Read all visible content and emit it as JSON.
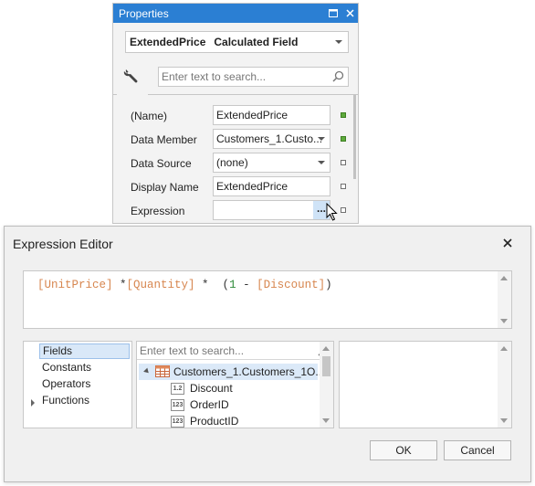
{
  "properties_panel": {
    "title": "Properties",
    "object_name": "ExtendedPrice",
    "object_type": "Calculated Field",
    "search_placeholder": "Enter text to search...",
    "rows": [
      {
        "label": "(Name)",
        "value": "ExtendedPrice",
        "marker": "green"
      },
      {
        "label": "Data Member",
        "value": "Customers_1.Custo...",
        "marker": "green"
      },
      {
        "label": "Data Source",
        "value": "(none)",
        "marker": "empty"
      },
      {
        "label": "Display Name",
        "value": "ExtendedPrice",
        "marker": "empty"
      },
      {
        "label": "Expression",
        "value": "",
        "marker": "empty"
      }
    ],
    "ellipsis_label": "...",
    "accent_color": "#2b7fd3"
  },
  "expression_editor": {
    "title": "Expression Editor",
    "expression": {
      "f1": "[UnitPrice]",
      "op1": " *",
      "f2": "[Quantity]",
      "op2": " *  (",
      "num": "1",
      "op3": " - ",
      "f3": "[Discount]",
      "op4": ")"
    },
    "categories": [
      "Fields",
      "Constants",
      "Operators",
      "Functions"
    ],
    "selected_category": "Fields",
    "list_search_placeholder": "Enter text to search...",
    "tree_parent": "Customers_1.Customers_1O...",
    "fields": [
      {
        "name": "Discount",
        "type_icon": "1.2"
      },
      {
        "name": "OrderID",
        "type_icon": "123"
      },
      {
        "name": "ProductID",
        "type_icon": "123"
      }
    ],
    "ok_label": "OK",
    "cancel_label": "Cancel"
  }
}
